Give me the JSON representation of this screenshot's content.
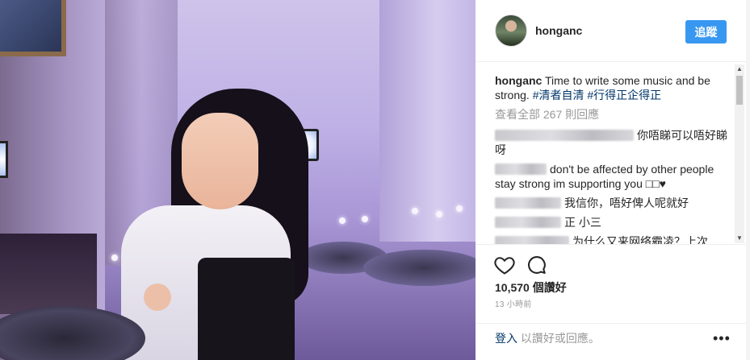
{
  "post": {
    "username": "hongan c",
    "follow_label": "追蹤",
    "caption_user": "honganc",
    "caption_text": "Time to write some music and be strong.",
    "hashtags": [
      "#清者自清",
      "#行得正企得正"
    ],
    "view_all": "查看全部 267 則回應",
    "comments": [
      {
        "text": "你唔睇可以唔好睇呀"
      },
      {
        "text": "don't be affected by other people stay strong im supporting you □□♥"
      },
      {
        "text": "我信你，唔好俾人呢就好"
      },
      {
        "text": "正 小三"
      },
      {
        "text": "为什么又来网络霸凌？上次"
      }
    ],
    "likes": "10,570 個讚好",
    "time": "13 小時前",
    "login_link": "登入",
    "login_suffix": "以讚好或回應。",
    "more": "•••"
  }
}
